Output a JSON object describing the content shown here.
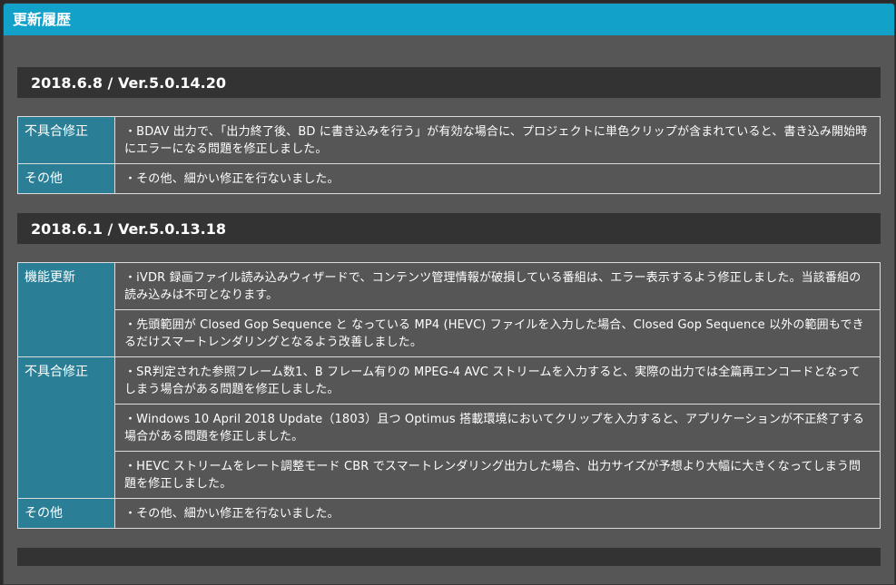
{
  "page": {
    "title": "更新履歴"
  },
  "releases": [
    {
      "heading": "2018.6.8 / Ver.5.0.14.20",
      "groups": [
        {
          "category": "不具合修正",
          "items": [
            "・BDAV 出力で、「出力終了後、BD に書き込みを行う」が有効な場合に、プロジェクトに単色クリップが含まれていると、書き込み開始時にエラーになる問題を修正しました。"
          ]
        },
        {
          "category": "その他",
          "items": [
            "・その他、細かい修正を行ないました。"
          ]
        }
      ]
    },
    {
      "heading": "2018.6.1 / Ver.5.0.13.18",
      "groups": [
        {
          "category": "機能更新",
          "items": [
            "・iVDR 録画ファイル読み込みウィザードで、コンテンツ管理情報が破損している番組は、エラー表示するよう修正しました。当該番組の読み込みは不可となります。",
            "・先頭範囲が Closed Gop Sequence と なっている MP4 (HEVC) ファイルを入力した場合、Closed Gop Sequence 以外の範囲もできるだけスマートレンダリングとなるよう改善しました。"
          ]
        },
        {
          "category": "不具合修正",
          "items": [
            "・SR判定された参照フレーム数1、B フレーム有りの MPEG-4 AVC ストリームを入力すると、実際の出力では全篇再エンコードとなってしまう場合がある問題を修正しました。",
            "・Windows 10 April 2018 Update（1803）且つ Optimus 搭載環境においてクリップを入力すると、アプリケーションが不正終了する場合がある問題を修正しました。",
            "・HEVC ストリームをレート調整モード CBR でスマートレンダリング出力した場合、出力サイズが予想より大幅に大きくなってしまう問題を修正しました。"
          ]
        },
        {
          "category": "その他",
          "items": [
            "・その他、細かい修正を行ないました。"
          ]
        }
      ]
    }
  ]
}
